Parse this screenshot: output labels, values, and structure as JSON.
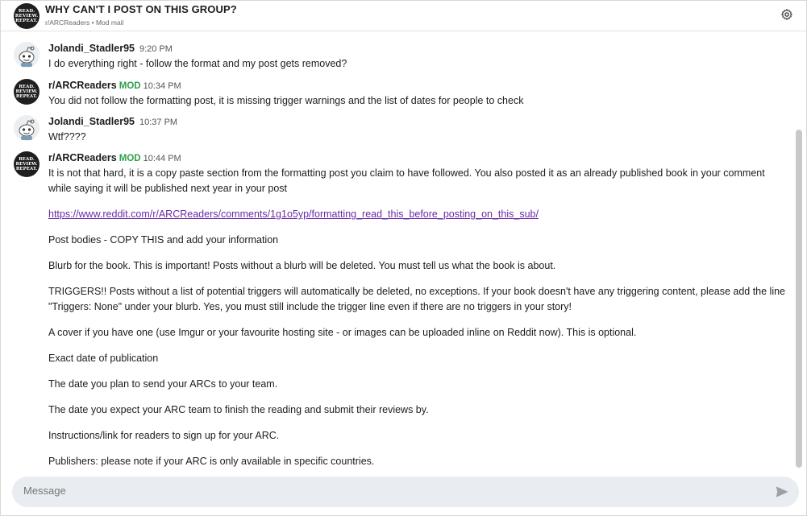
{
  "header": {
    "avatar_text": "READ. REVIEW. REPEAT.",
    "title": "WHY CAN'T I POST ON THIS GROUP?",
    "subtitle": "r/ARCReaders • Mod mail"
  },
  "messages": [
    {
      "author": "Jolandi_Stadler95",
      "mod": "",
      "time": "9:20 PM",
      "lines": [
        "I do everything right - follow the format and my post gets removed?"
      ]
    },
    {
      "author": "r/ARCReaders",
      "mod": "MOD",
      "time": "10:34 PM",
      "lines": [
        "You did not follow the formatting post, it is missing trigger warnings and the list of dates for people to check"
      ]
    },
    {
      "author": "Jolandi_Stadler95",
      "mod": "",
      "time": "10:37 PM",
      "lines": [
        "Wtf????"
      ]
    },
    {
      "author": "r/ARCReaders",
      "mod": "MOD",
      "time": "10:44 PM",
      "paragraphs": [
        "It is not that hard, it is a copy paste section from the formatting post you claim to have followed. You also posted it as an already published book in your comment while saying it will be published next year in your post",
        "https://www.reddit.com/r/ARCReaders/comments/1g1o5yp/formatting_read_this_before_posting_on_this_sub/",
        "Post bodies - COPY THIS and add your information",
        "Blurb for the book. This is important! Posts without a blurb will be deleted. You must tell us what the book is about.",
        "TRIGGERS!! Posts without a list of potential triggers will automatically be deleted, no exceptions. If your book doesn't have any triggering content, please add the line \"Triggers: None\" under your blurb. Yes, you must still include the trigger line even if there are no triggers in your story!",
        "A cover if you have one (use Imgur or your favourite hosting site - or images can be uploaded inline on Reddit now). This is optional.",
        "Exact date of publication",
        "The date you plan to send your ARCs to your team.",
        "The date you expect your ARC team to finish the reading and submit their reviews by.",
        "Instructions/link for readers to sign up for your ARC.",
        "Publishers: please note if your ARC is only available in specific countries."
      ]
    }
  ],
  "composer": {
    "placeholder": "Message"
  },
  "colors": {
    "mod_green": "#2e9f4a",
    "link_purple": "#6a2aa8",
    "composer_bg": "#e9edf1"
  },
  "icons": [
    "gear-icon",
    "send-icon"
  ]
}
